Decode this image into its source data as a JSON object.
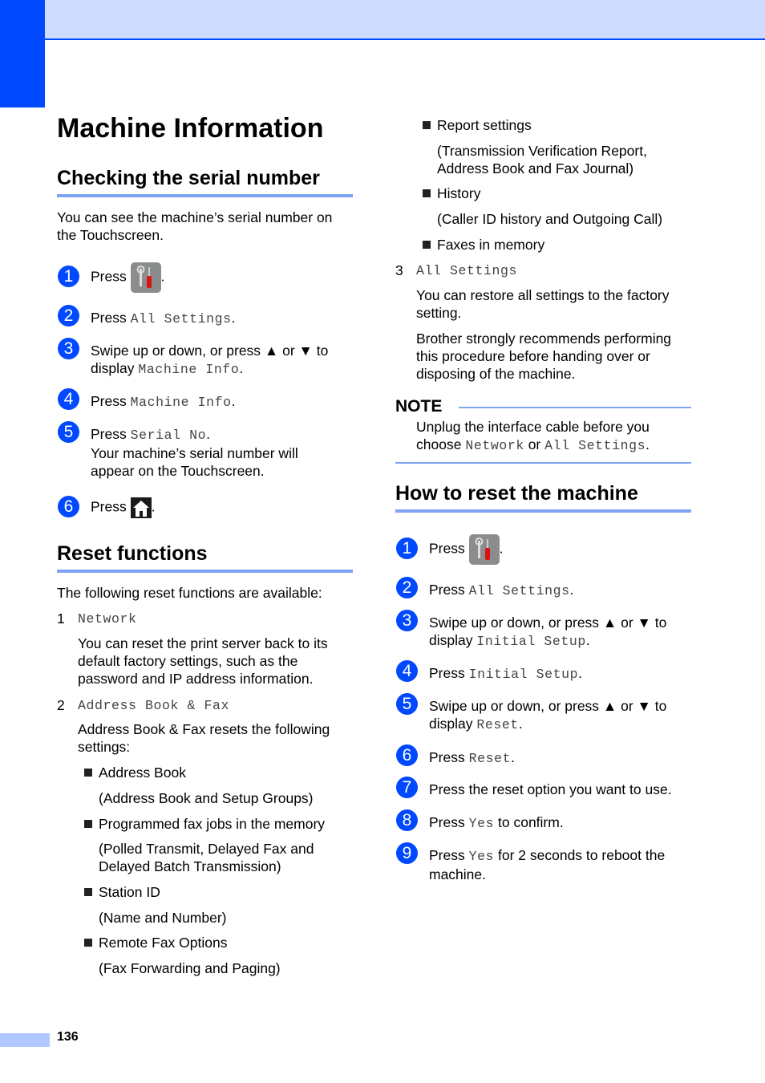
{
  "header": {
    "accent_color": "#0049ff",
    "band_color": "#cddcff"
  },
  "page_title": "Machine Information",
  "serial": {
    "heading": "Checking the serial number",
    "intro": "You can see the machine’s serial number on the Touchscreen.",
    "steps": [
      {
        "num": "1",
        "pre": "Press",
        "icon": "tools-icon",
        "post": "."
      },
      {
        "num": "2",
        "pre": "Press",
        "code": "All Settings",
        "post": "."
      },
      {
        "num": "3",
        "pre": "Swipe up or down, or press ▲ or ▼ to",
        "line2pre": "display",
        "code": "Machine Info",
        "post": "."
      },
      {
        "num": "4",
        "pre": "Press",
        "code": "Machine Info",
        "post": "."
      },
      {
        "num": "5",
        "pre": "Press",
        "code": "Serial No",
        "post": ".",
        "line2": "Your machine’s serial number will",
        "line3": "appear on the Touchscreen."
      },
      {
        "num": "6",
        "pre": "Press",
        "icon": "home-icon",
        "post": "."
      }
    ]
  },
  "reset": {
    "heading": "Reset functions",
    "intro": "The following reset functions are available:",
    "items": [
      {
        "num": "1",
        "code": "Network",
        "desc1": "You can reset the print server back to its",
        "desc2": "default factory settings, such as the",
        "desc3": "password and IP address information."
      },
      {
        "num": "2",
        "code": "Address Book & Fax",
        "desc1": "Address Book & Fax resets the following",
        "desc2": "settings:"
      },
      {
        "num": "3",
        "code": "All Settings",
        "desc1": "You can restore all settings to the factory",
        "desc2": "setting.",
        "desc3": "Brother strongly recommends performing",
        "desc4": "this procedure before handing over or",
        "desc5": "disposing of the machine."
      }
    ],
    "bullets": [
      {
        "label": "Address Book",
        "detail1": "(Address Book and Setup Groups)"
      },
      {
        "label": "Programmed fax jobs in the memory",
        "detail1": "(Polled Transmit, Delayed Fax and",
        "detail2": "Delayed Batch Transmission)"
      },
      {
        "label": "Station ID",
        "detail1": "(Name and Number)"
      },
      {
        "label": "Remote Fax Options",
        "detail1": "(Fax Forwarding and Paging)"
      },
      {
        "label": "Report settings",
        "detail1": "(Transmission Verification Report,",
        "detail2": "Address Book and Fax Journal)"
      },
      {
        "label": "History",
        "detail1": "(Caller ID history and Outgoing Call)"
      },
      {
        "label": "Faxes in memory"
      }
    ]
  },
  "note": {
    "title": "NOTE",
    "line1": "Unplug the interface cable before you",
    "pre": "choose",
    "code1": "Network",
    "mid": "or",
    "code2": "All Settings",
    "post": "."
  },
  "howto": {
    "heading": "How to reset the machine",
    "steps": [
      {
        "num": "1",
        "pre": "Press",
        "icon": "tools-icon",
        "post": "."
      },
      {
        "num": "2",
        "pre": "Press",
        "code": "All Settings",
        "post": "."
      },
      {
        "num": "3",
        "pre": "Swipe up or down, or press ▲ or ▼ to",
        "line2pre": "display",
        "code": "Initial Setup",
        "post": "."
      },
      {
        "num": "4",
        "pre": "Press",
        "code": "Initial Setup",
        "post": "."
      },
      {
        "num": "5",
        "pre": "Swipe up or down, or press ▲ or ▼ to",
        "line2pre": "display",
        "code": "Reset",
        "post": "."
      },
      {
        "num": "6",
        "pre": "Press",
        "code": "Reset",
        "post": "."
      },
      {
        "num": "7",
        "pre": "Press the reset option you want to use."
      },
      {
        "num": "8",
        "pre": "Press",
        "code": "Yes",
        "post": "to confirm."
      },
      {
        "num": "9",
        "pre": "Press",
        "code": "Yes",
        "post": "for 2 seconds to reboot the",
        "line2": "machine."
      }
    ]
  },
  "footer": {
    "page_number": "136"
  }
}
